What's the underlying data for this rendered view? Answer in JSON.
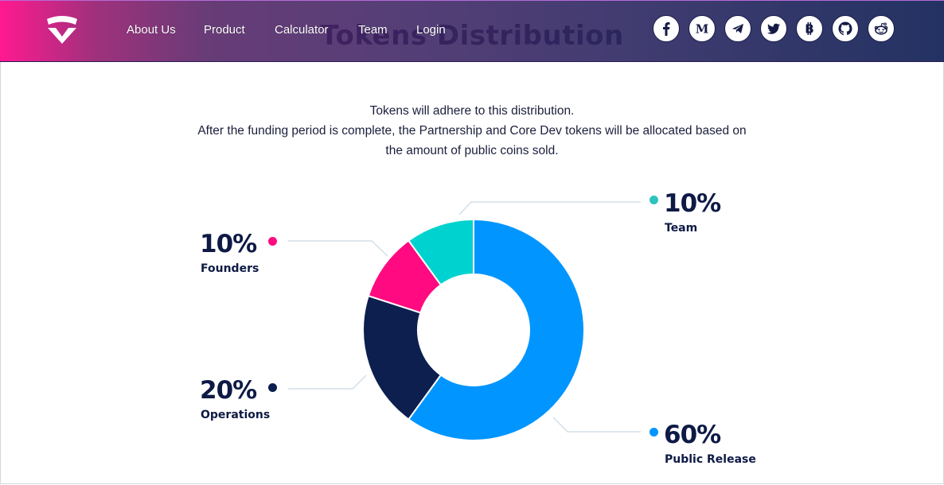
{
  "section": {
    "title": "Tokens Distribution",
    "intro_lines": [
      "Tokens will adhere to this distribution.",
      "After the funding period is complete, the Partnership and Core Dev tokens will be allocated based on",
      "the amount of public coins sold."
    ]
  },
  "header": {
    "logo": "shield-v-logo",
    "nav": [
      {
        "label": "About Us"
      },
      {
        "label": "Product"
      },
      {
        "label": "Calculator"
      },
      {
        "label": "Team"
      },
      {
        "label": "Login"
      }
    ],
    "socials": [
      {
        "name": "facebook",
        "icon": "facebook-icon"
      },
      {
        "name": "medium",
        "icon": "medium-icon"
      },
      {
        "name": "telegram",
        "icon": "telegram-icon"
      },
      {
        "name": "twitter",
        "icon": "twitter-icon"
      },
      {
        "name": "bitcoin",
        "icon": "bitcoin-icon"
      },
      {
        "name": "github",
        "icon": "github-icon"
      },
      {
        "name": "reddit",
        "icon": "reddit-icon"
      }
    ]
  },
  "colors": {
    "public_release": "#0095ff",
    "operations": "#0c1f4e",
    "founders": "#ff0a80",
    "team": "#00d3cf",
    "leader_line": "#d3dfe8",
    "team_dot": "#2ec4bd"
  },
  "chart_data": {
    "type": "pie",
    "donut": true,
    "title": "Tokens Distribution",
    "unit": "%",
    "start": "top, clockwise",
    "slices": [
      {
        "label": "Public Release",
        "value": 60,
        "display": "60%",
        "color": "#0095ff"
      },
      {
        "label": "Operations",
        "value": 20,
        "display": "20%",
        "color": "#0c1f4e"
      },
      {
        "label": "Founders",
        "value": 10,
        "display": "10%",
        "color": "#ff0a80"
      },
      {
        "label": "Team",
        "value": 10,
        "display": "10%",
        "color": "#00d3cf"
      }
    ]
  }
}
